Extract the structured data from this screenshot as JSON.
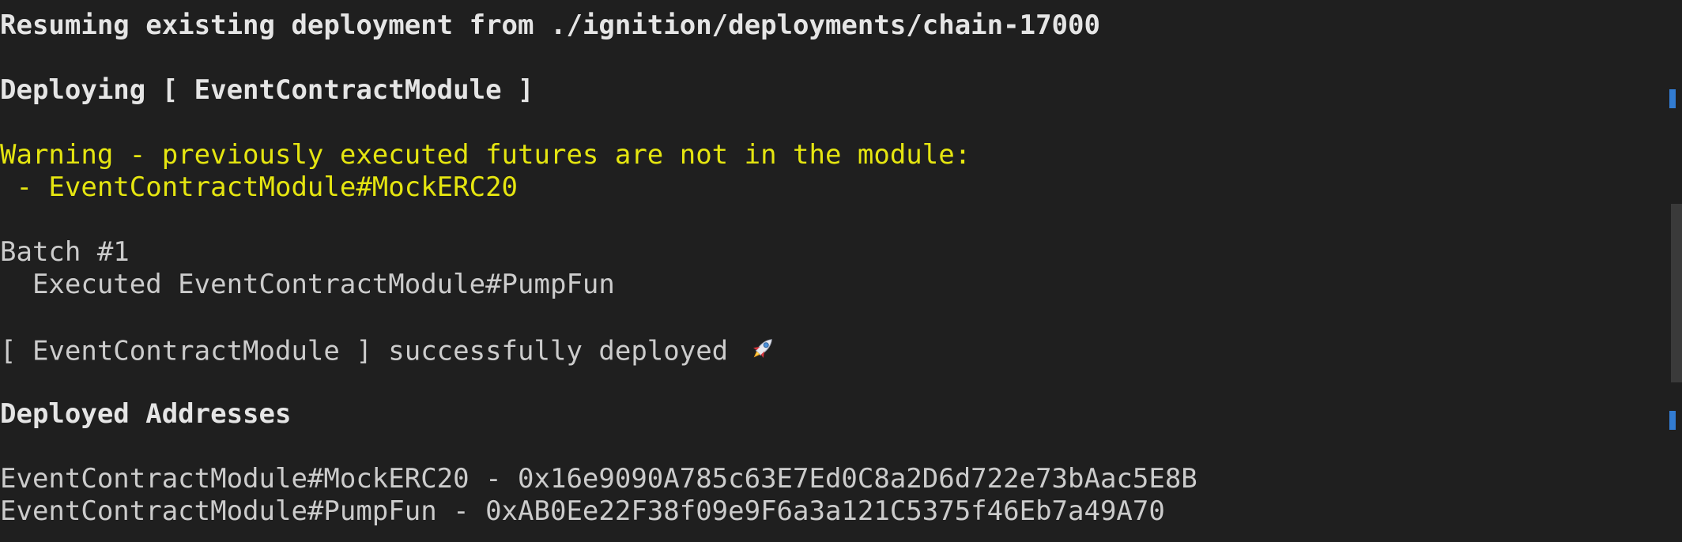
{
  "terminal": {
    "resume_line": "Resuming existing deployment from ./ignition/deployments/chain-17000",
    "deploying_line": "Deploying [ EventContractModule ]",
    "warning_line": "Warning - previously executed futures are not in the module:",
    "warning_item": " - EventContractModule#MockERC20",
    "batch_line": "Batch #1",
    "executed_line": "  Executed EventContractModule#PumpFun",
    "success_line": "[ EventContractModule ] successfully deployed",
    "addresses_heading": "Deployed Addresses",
    "address_1": "EventContractModule#MockERC20 - 0x16e9090A785c63E7Ed0C8a2D6d722e73bAac5E8B",
    "address_2": "EventContractModule#PumpFun - 0xAB0Ee22F38f09e9F6a3a121C5375f46Eb7a49A70"
  },
  "icons": {
    "success_emoji": "rocket-icon"
  },
  "colors": {
    "background": "#1f1f1f",
    "text": "#cccccc",
    "warning": "#e5e510",
    "scroll_marker": "#3794ff"
  }
}
